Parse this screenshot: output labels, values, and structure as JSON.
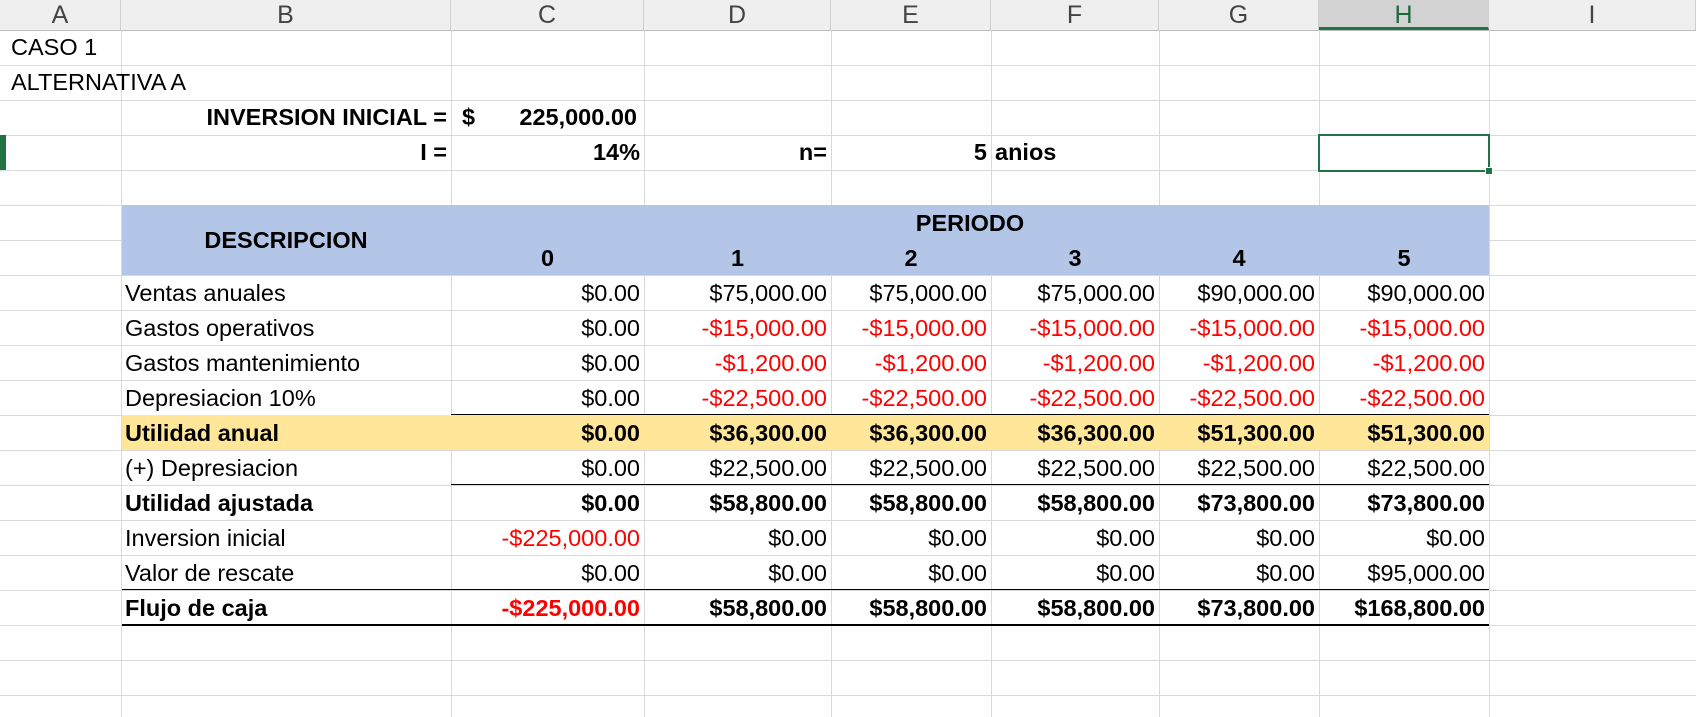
{
  "columns": [
    "A",
    "B",
    "C",
    "D",
    "E",
    "F",
    "G",
    "H",
    "I"
  ],
  "selected_column": "H",
  "header": {
    "case": "CASO 1",
    "alternative": "ALTERNATIVA A",
    "investment_label": "INVERSION INICIAL =",
    "currency_symbol": "$",
    "investment_value": "225,000.00",
    "rate_label": "I =",
    "rate_value": "14%",
    "n_label": "n=",
    "n_value": "5",
    "n_unit": "anios"
  },
  "table": {
    "description_header": "DESCRIPCION",
    "period_header": "PERIODO",
    "periods": [
      "0",
      "1",
      "2",
      "3",
      "4",
      "5"
    ],
    "rows": [
      {
        "label": "Ventas anuales",
        "values": [
          "$0.00",
          "$75,000.00",
          "$75,000.00",
          "$75,000.00",
          "$90,000.00",
          "$90,000.00"
        ]
      },
      {
        "label": "Gastos operativos",
        "values": [
          "$0.00",
          "-$15,000.00",
          "-$15,000.00",
          "-$15,000.00",
          "-$15,000.00",
          "-$15,000.00"
        ]
      },
      {
        "label": "Gastos mantenimiento",
        "values": [
          "$0.00",
          "-$1,200.00",
          "-$1,200.00",
          "-$1,200.00",
          "-$1,200.00",
          "-$1,200.00"
        ]
      },
      {
        "label": "Depresiacion 10%",
        "values": [
          "$0.00",
          "-$22,500.00",
          "-$22,500.00",
          "-$22,500.00",
          "-$22,500.00",
          "-$22,500.00"
        ]
      },
      {
        "label": "Utilidad anual",
        "values": [
          "$0.00",
          "$36,300.00",
          "$36,300.00",
          "$36,300.00",
          "$51,300.00",
          "$51,300.00"
        ]
      },
      {
        "label": "(+) Depresiacion",
        "values": [
          "$0.00",
          "$22,500.00",
          "$22,500.00",
          "$22,500.00",
          "$22,500.00",
          "$22,500.00"
        ]
      },
      {
        "label": "Utilidad ajustada",
        "values": [
          "$0.00",
          "$58,800.00",
          "$58,800.00",
          "$58,800.00",
          "$73,800.00",
          "$73,800.00"
        ]
      },
      {
        "label": "Inversion inicial",
        "values": [
          "-$225,000.00",
          "$0.00",
          "$0.00",
          "$0.00",
          "$0.00",
          "$0.00"
        ]
      },
      {
        "label": "Valor de rescate",
        "values": [
          "$0.00",
          "$0.00",
          "$0.00",
          "$0.00",
          "$0.00",
          "$95,000.00"
        ]
      },
      {
        "label": "Flujo de caja",
        "values": [
          "-$225,000.00",
          "$58,800.00",
          "$58,800.00",
          "$58,800.00",
          "$73,800.00",
          "$168,800.00"
        ]
      }
    ]
  },
  "colors": {
    "header_band": "#b4c6e7",
    "highlight_row": "#ffe699",
    "negative": "#ff0000",
    "selection": "#217346"
  }
}
